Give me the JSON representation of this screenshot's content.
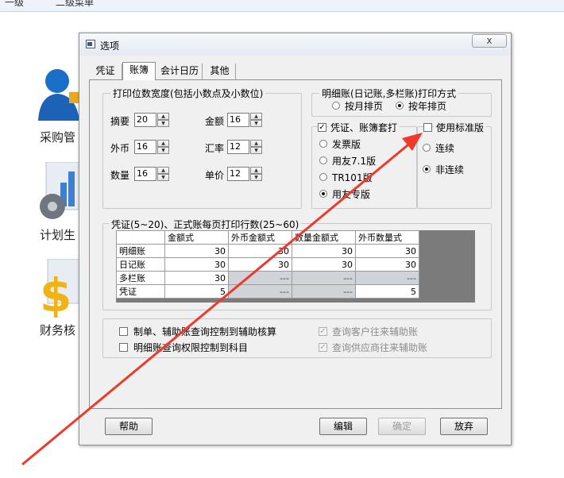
{
  "background": {
    "menu_items": [
      "一级",
      "二级菜单"
    ],
    "labels": [
      "采购管",
      "计划生",
      "财务核"
    ]
  },
  "dialog": {
    "title": "选项",
    "close_glyph": "x",
    "tabs": [
      {
        "label": "凭证",
        "selected": false
      },
      {
        "label": "账簿",
        "selected": true
      },
      {
        "label": "会计日历",
        "selected": false
      },
      {
        "label": "其他",
        "selected": false
      }
    ],
    "print_width": {
      "title": "打印位数宽度(包括小数点及小数位)",
      "fields": [
        {
          "label": "摘要",
          "value": "20"
        },
        {
          "label": "金额",
          "value": "16"
        },
        {
          "label": "外币",
          "value": "16"
        },
        {
          "label": "汇率",
          "value": "12"
        },
        {
          "label": "数量",
          "value": "16"
        },
        {
          "label": "单价",
          "value": "12"
        }
      ]
    },
    "detail_print": {
      "title": "明细账(日记账,多栏账)打印方式",
      "options": [
        {
          "label": "按月排页",
          "selected": false
        },
        {
          "label": "按年排页",
          "selected": true
        }
      ]
    },
    "voucher_set": {
      "checkbox_label": "凭证、账簿套打",
      "checked": true,
      "options": [
        {
          "label": "发票版",
          "selected": false
        },
        {
          "label": "用友7.1版",
          "selected": false
        },
        {
          "label": "TR101版",
          "selected": false
        },
        {
          "label": "用友专版",
          "selected": true
        }
      ]
    },
    "standard_version": {
      "checkbox_label": "使用标准版",
      "checked": false,
      "options": [
        {
          "label": "连续",
          "selected": false
        },
        {
          "label": "非连续",
          "selected": true
        }
      ]
    },
    "rows_per_page": {
      "title": "凭证(5~20)、正式账每页打印行数(25~60)",
      "columns": [
        "",
        "金额式",
        "外币金额式",
        "数量金额式",
        "外币数量式"
      ],
      "rows": [
        {
          "name": "明细账",
          "values": [
            "30",
            "30",
            "30",
            "30"
          ],
          "gray": [
            false,
            false,
            false,
            false
          ]
        },
        {
          "name": "日记账",
          "values": [
            "30",
            "30",
            "30",
            "30"
          ],
          "gray": [
            false,
            false,
            false,
            false
          ]
        },
        {
          "name": "多栏账",
          "values": [
            "30",
            "---",
            "---",
            "---"
          ],
          "gray": [
            false,
            true,
            true,
            true
          ]
        },
        {
          "name": "凭证",
          "values": [
            "5",
            "---",
            "---",
            "5"
          ],
          "gray": [
            false,
            true,
            true,
            false
          ]
        }
      ]
    },
    "query_options": [
      {
        "label": "制单、辅助账查询控制到辅助核算",
        "checked": false,
        "disabled": false
      },
      {
        "label": "明细账查询权限控制到科目",
        "checked": false,
        "disabled": false
      },
      {
        "label": "查询客户往来辅助账",
        "checked": true,
        "disabled": true
      },
      {
        "label": "查询供应商往来辅助账",
        "checked": true,
        "disabled": true
      }
    ],
    "buttons": {
      "help": "帮助",
      "edit": "编辑",
      "ok": "确定",
      "cancel": "放弃"
    }
  },
  "annotation": {
    "color": "#ee3a2c"
  }
}
